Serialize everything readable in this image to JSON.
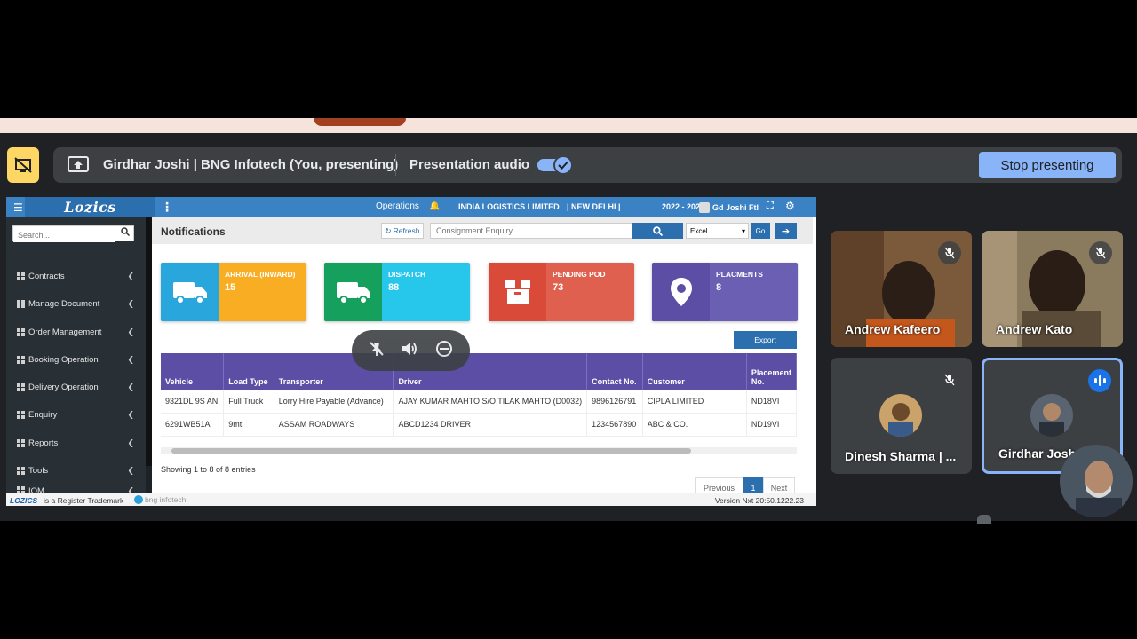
{
  "meet": {
    "presenter_text": "Girdhar Joshi | BNG Infotech (You, presenting)",
    "presentation_audio_label": "Presentation audio",
    "stop_presenting_label": "Stop presenting",
    "accent_color": "#8ab4f8",
    "participants": [
      {
        "name": "Andrew Kafeero",
        "muted": true
      },
      {
        "name": "Andrew Kato",
        "muted": true
      },
      {
        "name": "Dinesh Sharma | ...",
        "muted": true
      },
      {
        "name": "Girdhar Josh",
        "muted": false,
        "speaking": true
      }
    ]
  },
  "app": {
    "logo": "Lozics",
    "header": {
      "module": "Operations",
      "company": "INDIA LOGISTICS LIMITED",
      "city": "| NEW DELHI |",
      "year": "2022 - 2023",
      "user": "Gd Joshi Ftl"
    },
    "sidebar": {
      "search_placeholder": "Search...",
      "items": [
        {
          "label": "Contracts"
        },
        {
          "label": "Manage Document"
        },
        {
          "label": "Order Management"
        },
        {
          "label": "Booking Operation"
        },
        {
          "label": "Delivery Operation"
        },
        {
          "label": "Enquiry"
        },
        {
          "label": "Reports"
        },
        {
          "label": "Tools"
        },
        {
          "label": "IOM"
        }
      ]
    },
    "page_title": "Notifications",
    "toolbar": {
      "refresh_label": "Refresh",
      "consignment_placeholder": "Consignment Enquiry",
      "format_selected": "Excel",
      "go_label": "Go"
    },
    "cards": [
      {
        "title": "ARRIVAL (INWARD)",
        "count": "15",
        "icon": "truck-icon",
        "icon_bg": "#29a7dd",
        "bg": "#f9ad22"
      },
      {
        "title": "DISPATCH",
        "count": "88",
        "icon": "truck-icon",
        "icon_bg": "#16a05d",
        "bg": "#27c7ec"
      },
      {
        "title": "PENDING POD",
        "count": "73",
        "icon": "box-icon",
        "icon_bg": "#d94a38",
        "bg": "#e0604f"
      },
      {
        "title": "PLACMENTS",
        "count": "8",
        "icon": "map-pin-icon",
        "icon_bg": "#5b4ea4",
        "bg": "#6a5fb2"
      }
    ],
    "export_label": "Export",
    "table": {
      "headers": [
        "Vehicle",
        "Load Type",
        "Transporter",
        "Driver",
        "Contact No.",
        "Customer",
        "Placement No."
      ],
      "rows": [
        [
          "9321DL 9S AN",
          "Full Truck",
          "Lorry Hire Payable (Advance)",
          "AJAY KUMAR MAHTO S/O TILAK MAHTO (D0032)",
          "9896126791",
          "CIPLA LIMITED",
          "ND18VI"
        ],
        [
          "6291WB51A",
          "9mt",
          "ASSAM ROADWAYS",
          "ABCD1234 DRIVER",
          "1234567890",
          "ABC & CO.",
          "ND19VI"
        ]
      ]
    },
    "showing_text": "Showing 1 to 8 of 8 entries",
    "pager": {
      "prev": "Previous",
      "current": "1",
      "next": "Next"
    },
    "footer": {
      "brand": "LOZICS",
      "tm_text": "is a Register Trademark",
      "bng": "bng infotech",
      "version": "Version Nxt 20:50.1222.23"
    }
  }
}
